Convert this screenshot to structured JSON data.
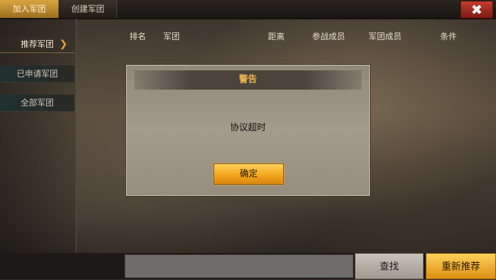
{
  "tabs": {
    "join": "加入军团",
    "create": "创建军团"
  },
  "close_glyph": "✖",
  "sidebar": {
    "items": [
      {
        "label": "推荐军团",
        "chevron": "❯"
      },
      {
        "label": "已申请军团"
      },
      {
        "label": "全部军团"
      }
    ]
  },
  "table": {
    "headers": [
      "排名",
      "军团",
      "距离",
      "参战成员",
      "军团成员",
      "条件"
    ]
  },
  "dialog": {
    "title": "警告",
    "message": "协议超时",
    "confirm_label": "确定"
  },
  "bottom": {
    "search_value": "",
    "find_label": "查找",
    "recommend_label": "重新推荐"
  },
  "colors": {
    "accent_gold": "#f3a51e",
    "close_red": "#c23b2f",
    "title_orange": "#f2b94a"
  }
}
